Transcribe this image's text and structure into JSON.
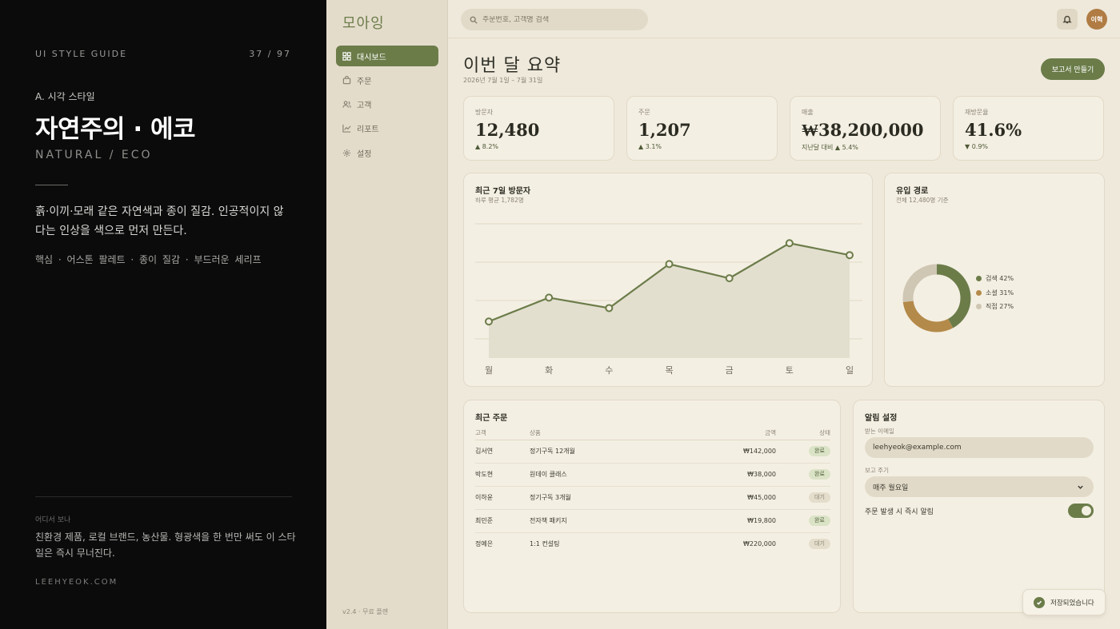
{
  "guide": {
    "title": "UI STYLE GUIDE",
    "page": "37 / 97",
    "section": "A. 시각 스타일",
    "style_name": "자연주의 · 에코",
    "style_name_en": "NATURAL / ECO",
    "description": "흙·이끼·모래 같은 자연색과 종이 질감. 인공적이지 않다는 인상을 색으로 먼저 만든다.",
    "keywords": "핵심  ·  어스톤 팔레트  ·  종이 질감  ·  부드러운 세리프",
    "where_label": "어디서 보나",
    "where_text": "친환경 제품, 로컬 브랜드, 농산물. 형광색을 한 번만 써도 이 스타일은 즉시 무너진다.",
    "site": "LEEHYEOK.COM"
  },
  "app": {
    "logo": "모아잉",
    "nav": [
      {
        "label": "대시보드",
        "icon": "grid-icon",
        "active": true
      },
      {
        "label": "주문",
        "icon": "bag-icon",
        "active": false
      },
      {
        "label": "고객",
        "icon": "users-icon",
        "active": false
      },
      {
        "label": "리포트",
        "icon": "chart-icon",
        "active": false
      },
      {
        "label": "설정",
        "icon": "gear-icon",
        "active": false
      }
    ],
    "version": "v2.4 · 무료 플랜",
    "search_placeholder": "주문번호, 고객명 검색",
    "avatar_text": "이혁",
    "page_title": "이번 달 요약",
    "page_subtitle": "2026년 7월 1일 – 7월 31일",
    "report_button": "보고서 만들기",
    "kpis": [
      {
        "label": "방문자",
        "value": "12,480",
        "delta": "▲ 8.2%"
      },
      {
        "label": "주문",
        "value": "1,207",
        "delta": "▲ 3.1%"
      },
      {
        "label": "매출",
        "value": "₩38,200,000",
        "delta": "지난달 대비 ▲ 5.4%"
      },
      {
        "label": "재방문율",
        "value": "41.6%",
        "delta": "▼ 0.9%"
      }
    ],
    "visitors_card": {
      "title": "최근 7일 방문자",
      "subtitle": "하루 평균 1,782명"
    },
    "source_card": {
      "title": "유입 경로",
      "subtitle": "전체 12,480명 기준"
    },
    "orders_card": {
      "title": "최근 주문",
      "headers": [
        "고객",
        "상품",
        "금액",
        "상태"
      ],
      "rows": [
        {
          "customer": "김서연",
          "product": "정기구독 12개월",
          "amount": "₩142,000",
          "status": "완료",
          "done": true
        },
        {
          "customer": "박도현",
          "product": "원데이 클래스",
          "amount": "₩38,000",
          "status": "완료",
          "done": true
        },
        {
          "customer": "이하윤",
          "product": "정기구독 3개월",
          "amount": "₩45,000",
          "status": "대기",
          "done": false
        },
        {
          "customer": "최민준",
          "product": "전자책 패키지",
          "amount": "₩19,800",
          "status": "완료",
          "done": true
        },
        {
          "customer": "정예은",
          "product": "1:1 컨설팅",
          "amount": "₩220,000",
          "status": "대기",
          "done": false
        }
      ]
    },
    "alerts_card": {
      "title": "알림 설정",
      "email_label": "받는 이메일",
      "email_value": "leehyeok@example.com",
      "cycle_label": "보고 주기",
      "cycle_value": "매주 월요일",
      "instant_label": "주문 발생 시 즉시 알림",
      "instant_on": true
    },
    "toast": "저장되었습니다"
  },
  "chart_data": [
    {
      "type": "area",
      "x": [
        "월",
        "화",
        "수",
        "목",
        "금",
        "토",
        "일"
      ],
      "values": [
        1490,
        1810,
        1670,
        2260,
        2070,
        2540,
        2380
      ],
      "ylim": [
        1000,
        2800
      ],
      "grid": true,
      "color": "#6b7c49"
    },
    {
      "type": "pie",
      "donut": true,
      "categories": [
        "검색",
        "소셜",
        "직접"
      ],
      "values": [
        42,
        31,
        27
      ],
      "labels": [
        "검색 42%",
        "소셜 31%",
        "직접 27%"
      ],
      "colors": [
        "#6b7c49",
        "#b48a4a",
        "#cfc6b3"
      ]
    }
  ]
}
